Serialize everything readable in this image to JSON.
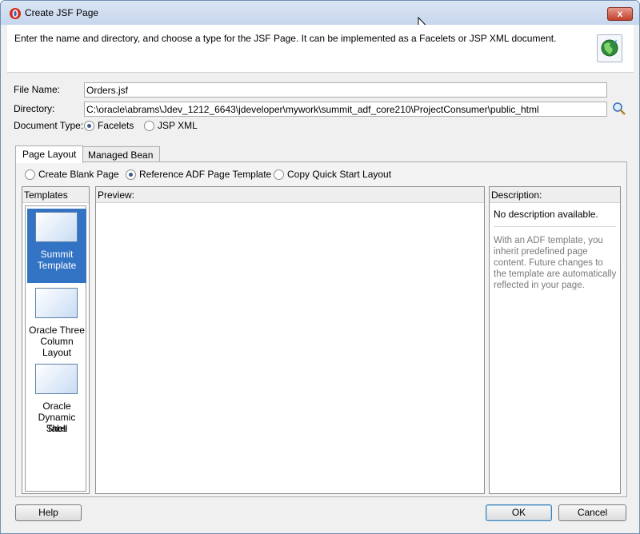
{
  "window": {
    "title": "Create JSF Page",
    "close_label": "x"
  },
  "header": {
    "description": "Enter the name and directory, and choose a type for the JSF Page. It can be implemented as a Facelets or JSP XML document."
  },
  "form": {
    "file_name_label": "File Name:",
    "file_name_value": "Orders.jsf",
    "directory_label": "Directory:",
    "directory_value": "C:\\oracle\\abrams\\Jdev_1212_6643\\jdeveloper\\mywork\\summit_adf_core210\\ProjectConsumer\\public_html",
    "document_type_label": "Document Type:",
    "document_types": [
      {
        "label": "Facelets",
        "checked": true
      },
      {
        "label": "JSP XML",
        "checked": false
      }
    ]
  },
  "tabs": [
    {
      "label": "Page Layout",
      "active": true
    },
    {
      "label": "Managed Bean",
      "active": false
    }
  ],
  "layout_options": [
    {
      "label": "Create Blank Page",
      "checked": false
    },
    {
      "label": "Reference ADF Page Template",
      "checked": true
    },
    {
      "label": "Copy Quick Start Layout",
      "checked": false
    }
  ],
  "templates": {
    "header": "Templates",
    "items": [
      {
        "line1": "Summit",
        "line2": "Template",
        "line3": "",
        "selected": true
      },
      {
        "line1": "Oracle Three",
        "line2": "Column Layout",
        "line3": "",
        "selected": false
      },
      {
        "line1": "Oracle",
        "line2": "Dynamic Tabs",
        "line3": "Shell",
        "selected": false
      }
    ]
  },
  "preview": {
    "header": "Preview:"
  },
  "description": {
    "header": "Description:",
    "text": "No description available.",
    "hint": "With an ADF template, you inherit predefined page content. Future changes to the template are automatically reflected in your page."
  },
  "buttons": {
    "help": "Help",
    "ok": "OK",
    "cancel": "Cancel"
  },
  "colors": {
    "selection": "#3373c4",
    "close_button": "#c2402b"
  }
}
